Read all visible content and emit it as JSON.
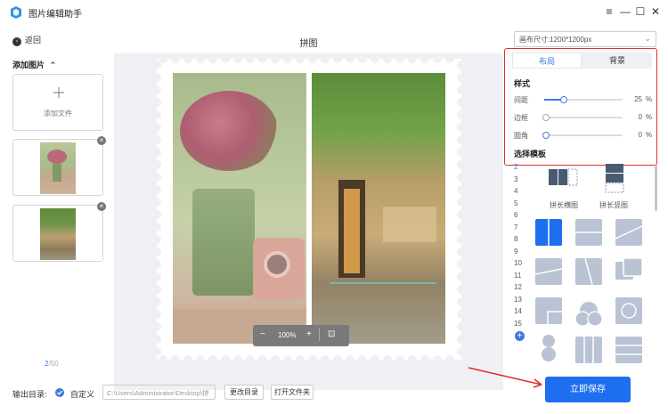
{
  "app": {
    "title": "图片编辑助手"
  },
  "window": {
    "minimize": "—",
    "menu": "≡",
    "maximize": "☐",
    "close": "✕"
  },
  "left": {
    "back_label": "返回",
    "add_images_label": "添加图片",
    "add_file_label": "添加文件",
    "page_current": "2",
    "page_total": "/50"
  },
  "canvas": {
    "title": "拼图",
    "zoom": "100%"
  },
  "right": {
    "canvas_size": "画布尺寸:1200*1200px",
    "tabs": [
      "布局",
      "背景"
    ],
    "style_label": "样式",
    "sliders": [
      {
        "name": "间距",
        "value": "25",
        "unit": "%",
        "level": 0.25
      },
      {
        "name": "边框",
        "value": "0",
        "unit": "%",
        "level": 0
      },
      {
        "name": "圆角",
        "value": "0",
        "unit": "%",
        "level": 0
      }
    ],
    "template_label": "选择模板",
    "template_numbers": [
      "2",
      "3",
      "4",
      "5",
      "6",
      "7",
      "8",
      "9",
      "10",
      "11",
      "12",
      "13",
      "14",
      "15"
    ],
    "big_templates": [
      "拼长横图",
      "拼长竖图"
    ],
    "add_symbol": "+"
  },
  "bottom": {
    "output_label": "输出目录:",
    "custom_label": "自定义",
    "path_value": "C:\\Users\\Administrator\\Desktop\\拼",
    "change_dir": "更改目录",
    "open_folder": "打开文件夹",
    "save": "立即保存"
  },
  "colors": {
    "accent": "#1e6ff0",
    "highlight_box": "#e0302a",
    "canvas_bg": "#eef0f4"
  }
}
